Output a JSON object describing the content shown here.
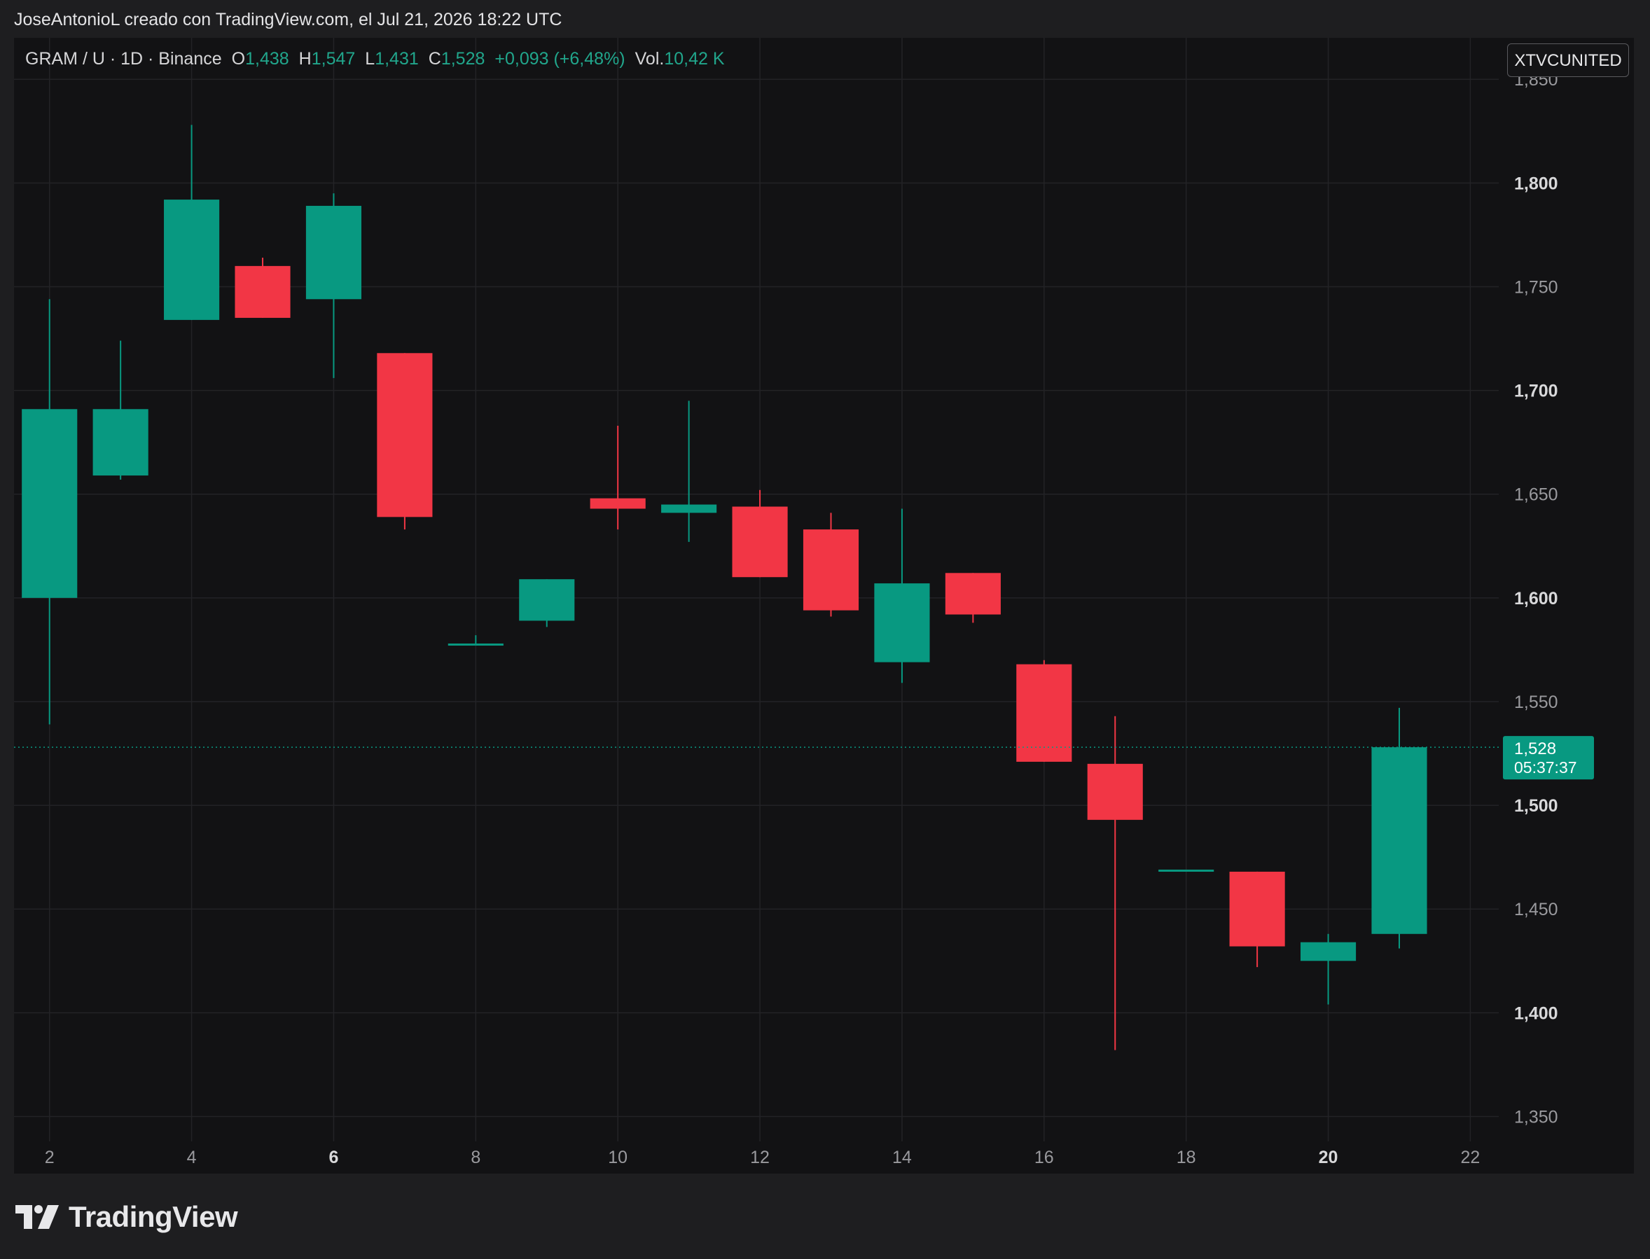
{
  "header": {
    "attribution": "JoseAntonioL creado con TradingView.com, el Jul 21, 2026 18:22 UTC"
  },
  "legend": {
    "symbol": "GRAM / U · 1D · Binance",
    "open_label": "O",
    "open": "1,438",
    "high_label": "H",
    "high": "1,547",
    "low_label": "L",
    "low": "1,431",
    "close_label": "C",
    "close": "1,528",
    "change": "+0,093 (+6,48%)",
    "vol_label": "Vol.",
    "vol": "10,42 K"
  },
  "badge": {
    "label": "XTVCUNITED"
  },
  "price_label": {
    "price": "1,528",
    "countdown": "05:37:37"
  },
  "logo": {
    "text": "TradingView"
  },
  "colors": {
    "up": "#089981",
    "down": "#f23645",
    "background": "#121214",
    "grid": "#232326"
  },
  "chart_data": {
    "type": "candlestick",
    "x_ticks": [
      "2",
      "4",
      "6",
      "8",
      "10",
      "12",
      "14",
      "16",
      "18",
      "20",
      "22"
    ],
    "x_ticks_bold": [
      "6",
      "20"
    ],
    "y_ticks": [
      "1,850",
      "1,800",
      "1,750",
      "1,700",
      "1,650",
      "1,600",
      "1,550",
      "1,500",
      "1,450",
      "1,400",
      "1,350"
    ],
    "y_ticks_bold": [
      "1,800",
      "1,700",
      "1,600",
      "1,500",
      "1,400"
    ],
    "xlim": [
      1.5,
      22.4
    ],
    "ylim": [
      1.338,
      1.87
    ],
    "last_price": 1.528,
    "candles": [
      {
        "day": 2,
        "open": 1.6,
        "high": 1.744,
        "low": 1.539,
        "close": 1.691
      },
      {
        "day": 3,
        "open": 1.659,
        "high": 1.724,
        "low": 1.657,
        "close": 1.691
      },
      {
        "day": 4,
        "open": 1.734,
        "high": 1.828,
        "low": 1.734,
        "close": 1.792
      },
      {
        "day": 5,
        "open": 1.76,
        "high": 1.764,
        "low": 1.735,
        "close": 1.735
      },
      {
        "day": 6,
        "open": 1.744,
        "high": 1.795,
        "low": 1.706,
        "close": 1.789
      },
      {
        "day": 7,
        "open": 1.718,
        "high": 1.718,
        "low": 1.633,
        "close": 1.639
      },
      {
        "day": 8,
        "open": 1.578,
        "high": 1.582,
        "low": 1.578,
        "close": 1.578
      },
      {
        "day": 9,
        "open": 1.589,
        "high": 1.609,
        "low": 1.586,
        "close": 1.609
      },
      {
        "day": 10,
        "open": 1.648,
        "high": 1.683,
        "low": 1.633,
        "close": 1.643
      },
      {
        "day": 11,
        "open": 1.641,
        "high": 1.695,
        "low": 1.627,
        "close": 1.645
      },
      {
        "day": 12,
        "open": 1.644,
        "high": 1.652,
        "low": 1.61,
        "close": 1.61
      },
      {
        "day": 13,
        "open": 1.633,
        "high": 1.641,
        "low": 1.591,
        "close": 1.594
      },
      {
        "day": 14,
        "open": 1.569,
        "high": 1.643,
        "low": 1.559,
        "close": 1.607
      },
      {
        "day": 15,
        "open": 1.612,
        "high": 1.612,
        "low": 1.588,
        "close": 1.592
      },
      {
        "day": 16,
        "open": 1.568,
        "high": 1.57,
        "low": 1.521,
        "close": 1.521
      },
      {
        "day": 17,
        "open": 1.52,
        "high": 1.543,
        "low": 1.382,
        "close": 1.493
      },
      {
        "day": 18,
        "open": 1.469,
        "high": 1.469,
        "low": 1.469,
        "close": 1.469
      },
      {
        "day": 19,
        "open": 1.468,
        "high": 1.468,
        "low": 1.422,
        "close": 1.432
      },
      {
        "day": 20,
        "open": 1.425,
        "high": 1.438,
        "low": 1.404,
        "close": 1.434
      },
      {
        "day": 21,
        "open": 1.438,
        "high": 1.547,
        "low": 1.431,
        "close": 1.528
      }
    ]
  }
}
